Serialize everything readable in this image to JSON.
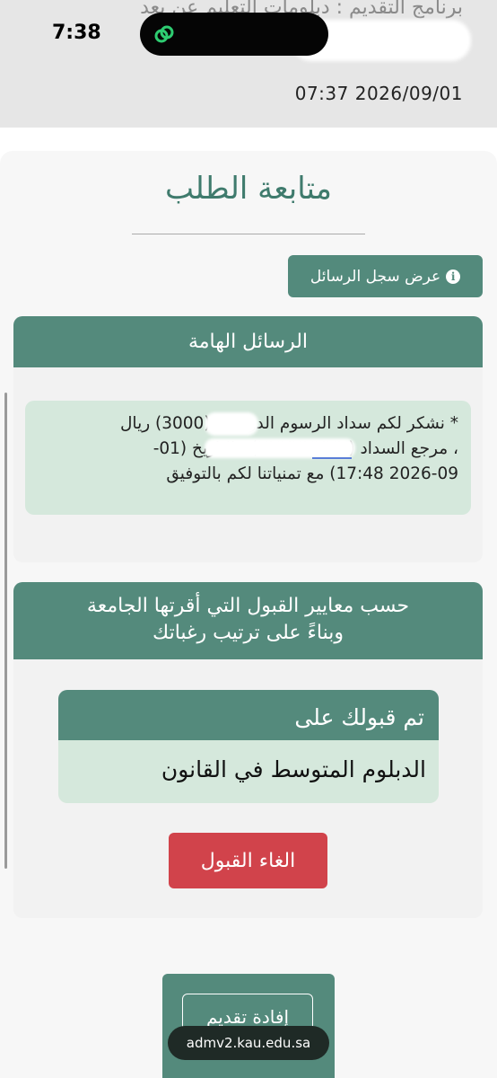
{
  "status_bar": {
    "time": "7:38"
  },
  "background_page": {
    "program_line": "برنامج التقديم : دبلومات التعليم عن بعد",
    "datetime": "07:37 2026/09/01"
  },
  "page": {
    "title": "متابعة الطلب",
    "view_log_button": "عرض سجل الرسائل"
  },
  "messages": {
    "header": "الرسائل الهامة",
    "lines": [
      "* نشكر لكم سداد الرسوم الدراسية (3000) ريال",
      "، مرجع السداد (XXXXXXXX) ، التاريخ (01-",
      "2026-09 17:48) مع تمنياتنا لكم بالتوفيق"
    ]
  },
  "admission": {
    "header_lines": [
      "حسب معايير القبول التي أقرتها الجامعة",
      "وبناءً على ترتيب رغباتك"
    ],
    "accepted_label": "تم قبولك على",
    "program": "الدبلوم المتوسط في القانون",
    "cancel_button": "الغاء القبول"
  },
  "bottom": {
    "statement_button": "إفادة تقديم"
  },
  "browser": {
    "url": "admv2.kau.edu.sa"
  },
  "colors": {
    "primary": "#548a7c",
    "title": "#3f7b6d",
    "message_bg": "#d5e8dc",
    "danger": "#d1434b"
  }
}
